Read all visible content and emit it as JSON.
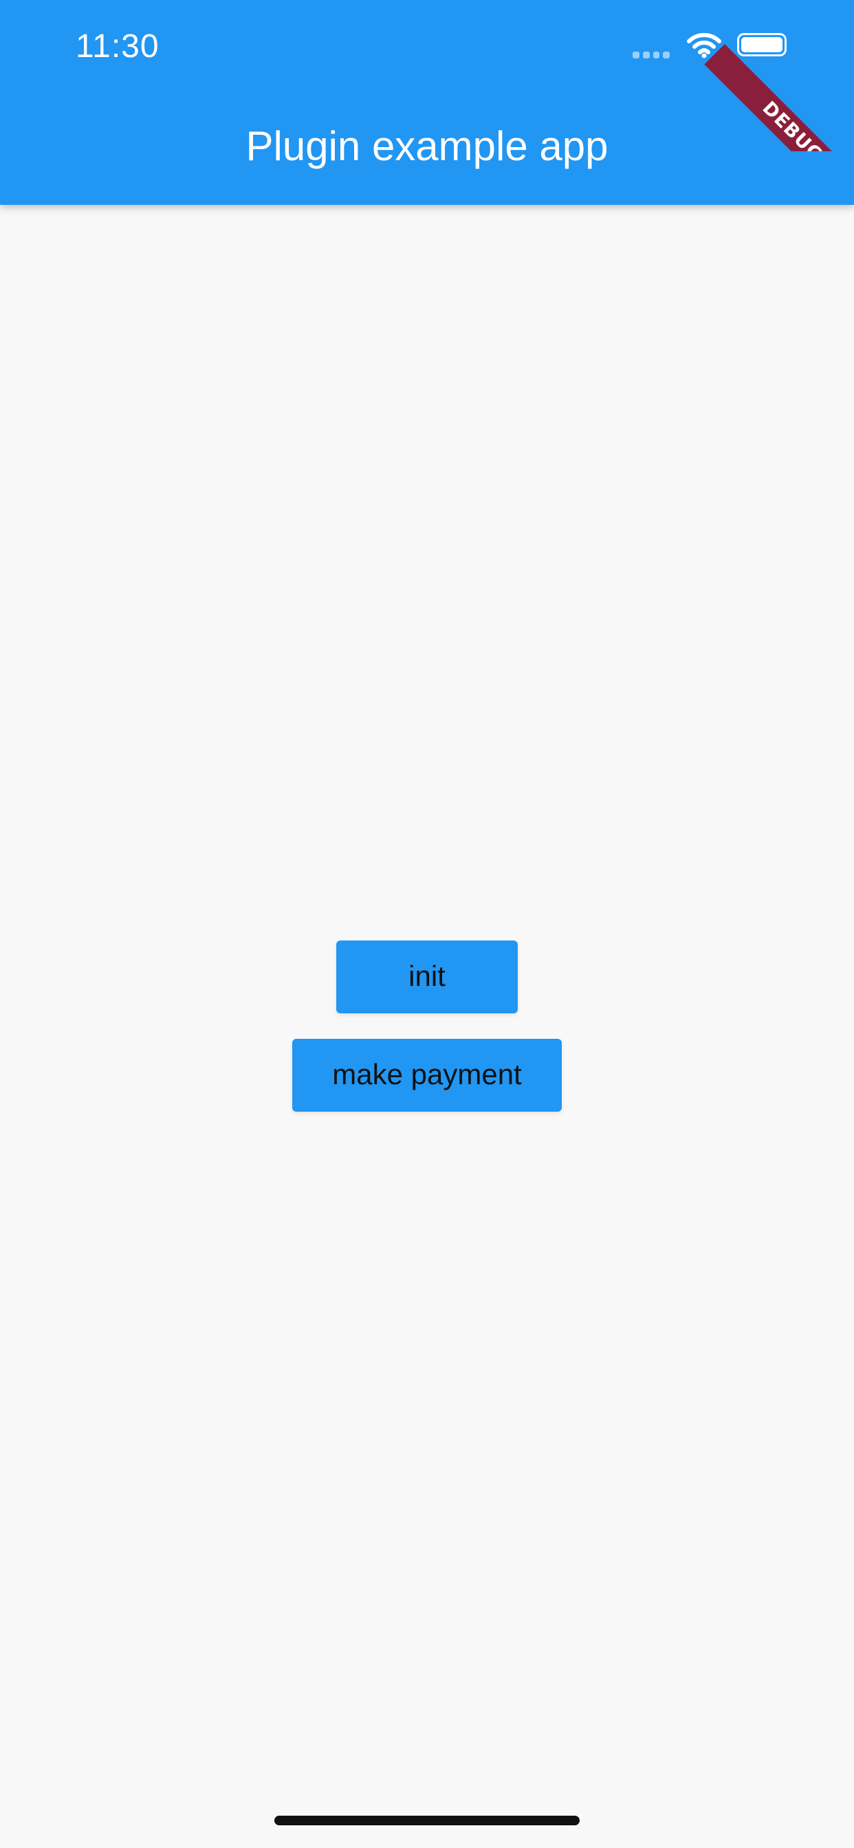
{
  "status_bar": {
    "time": "11:30",
    "wifi_icon": "wifi-icon",
    "battery_icon": "battery-icon",
    "signal_icon": "cellular-signal-icon"
  },
  "app_bar": {
    "title": "Plugin example app",
    "color": "#2196f3"
  },
  "debug_banner": {
    "label": "DEBUG",
    "color": "#8a1f3b"
  },
  "actions": {
    "init_label": "init",
    "make_payment_label": "make payment"
  },
  "colors": {
    "background": "#f8f8f8",
    "button": "#2196f3",
    "button_text": "#111111"
  }
}
